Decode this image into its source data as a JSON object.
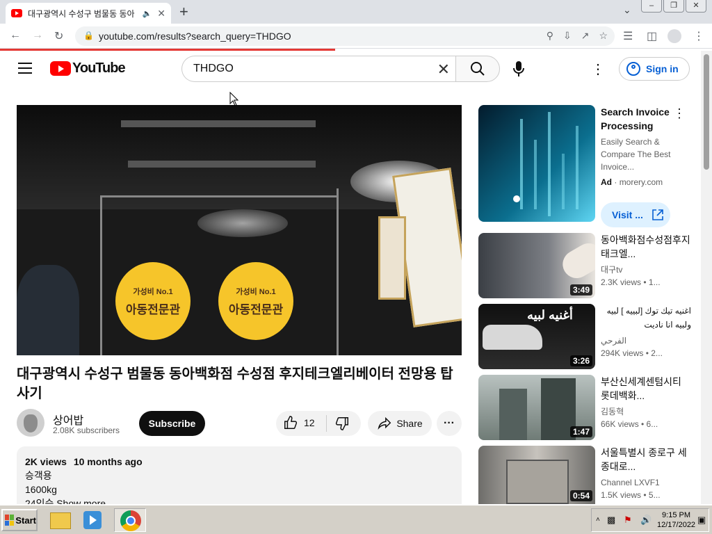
{
  "browser": {
    "tab_title": "대구광역시 수성구 범물동 동아",
    "url": "youtube.com/results?search_query=THDGO"
  },
  "youtube": {
    "logo_text": "YouTube",
    "search_query": "THDGO",
    "signin_label": "Sign in"
  },
  "video": {
    "title": "대구광역시 수성구 범물동 동아백화점 수성점 후지테크엘리베이터 전망용 탑사기",
    "channel": "상어밥",
    "subscribers": "2.08K subscribers",
    "subscribe_label": "Subscribe",
    "likes": "12",
    "share_label": "Share",
    "views": "2K views",
    "age": "10 months ago",
    "desc_lines": [
      "승객용",
      "1600kg",
      "24인승 Show more"
    ],
    "sticker_small": "가성비 No.1",
    "sticker_big": "아동전문관"
  },
  "sidebar": {
    "ad": {
      "title": "Search Invoice Processing",
      "description": "Easily Search & Compare The Best Invoice...",
      "badge": "Ad",
      "domain": "morery.com",
      "visit_label": "Visit ..."
    },
    "items": [
      {
        "title": "동아백화점수성점후지태크엘...",
        "channel": "대구tv",
        "meta": "2.3K views • 1...",
        "duration": "3:49"
      },
      {
        "title": "اغنيه تيك توك [لبييه ] لبيه ولبيه انا ناديت",
        "channel": "الفرحي",
        "meta": "294K views • 2...",
        "duration": "3:26",
        "thumb_text": "أغنيه لبيه"
      },
      {
        "title": "부산신세계센텀시티 롯데백화...",
        "channel": "김동혁",
        "meta": "66K views • 6...",
        "duration": "1:47"
      },
      {
        "title": "서울특별시 종로구 세종대로...",
        "channel": "Channel LXVF1",
        "meta": "1.5K views • 5...",
        "duration": "0:54"
      }
    ]
  },
  "taskbar": {
    "start_label": "Start",
    "time": "9:15 PM",
    "date": "12/17/2022"
  },
  "colors": {
    "youtube_red": "#ff0000",
    "link_blue": "#065fd4",
    "loading_red": "#e53935"
  }
}
